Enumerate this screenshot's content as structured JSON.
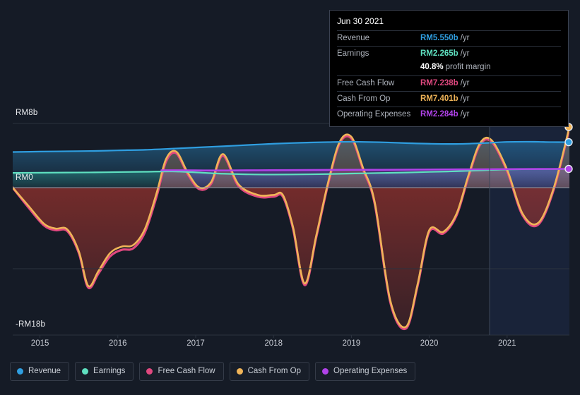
{
  "chart_data": {
    "type": "area",
    "title": "",
    "xlabel": "",
    "ylabel": "",
    "currency_prefix": "RM",
    "grid": true,
    "legend_position": "bottom",
    "x_tick_labels": [
      "2015",
      "2016",
      "2017",
      "2018",
      "2019",
      "2020",
      "2021"
    ],
    "x_tick_values": [
      2015,
      2016,
      2017,
      2018,
      2019,
      2020,
      2021
    ],
    "y_tick_labels": [
      "RM8b",
      "RM0",
      "-RM18b"
    ],
    "y_tick_values": [
      8,
      0,
      -18
    ],
    "ylim": [
      -18,
      8
    ],
    "xlim": [
      2014.65,
      2021.8
    ],
    "series": [
      {
        "name": "Revenue",
        "color": "#2f9ee0",
        "x": [
          2014.65,
          2015.0,
          2015.35,
          2015.7,
          2016.0,
          2016.35,
          2016.7,
          2017.0,
          2017.35,
          2017.7,
          2018.0,
          2018.35,
          2018.7,
          2019.0,
          2019.35,
          2019.7,
          2020.0,
          2020.35,
          2020.7,
          2021.0,
          2021.35,
          2021.55,
          2021.8
        ],
        "values": [
          4.35,
          4.4,
          4.44,
          4.48,
          4.55,
          4.62,
          4.76,
          4.9,
          5.05,
          5.22,
          5.36,
          5.48,
          5.56,
          5.6,
          5.55,
          5.44,
          5.36,
          5.33,
          5.44,
          5.58,
          5.6,
          5.56,
          5.55
        ]
      },
      {
        "name": "Earnings",
        "color": "#5fe0c0",
        "x": [
          2014.65,
          2015.0,
          2015.35,
          2015.7,
          2016.0,
          2016.35,
          2016.7,
          2017.0,
          2017.35,
          2017.7,
          2018.0,
          2018.35,
          2018.7,
          2019.0,
          2019.35,
          2019.7,
          2020.0,
          2020.35,
          2020.7,
          2021.0,
          2021.35,
          2021.55,
          2021.8
        ],
        "values": [
          1.8,
          1.82,
          1.84,
          1.86,
          1.9,
          1.94,
          1.98,
          1.86,
          1.7,
          1.62,
          1.6,
          1.62,
          1.66,
          1.72,
          1.78,
          1.84,
          1.92,
          2.0,
          2.12,
          2.22,
          2.26,
          2.27,
          2.265
        ]
      },
      {
        "name": "Free Cash Flow",
        "color": "#e0487f",
        "x": [
          2014.65,
          2014.85,
          2015.05,
          2015.2,
          2015.35,
          2015.5,
          2015.62,
          2015.75,
          2015.9,
          2016.05,
          2016.2,
          2016.35,
          2016.5,
          2016.62,
          2016.75,
          2016.9,
          2017.05,
          2017.2,
          2017.35,
          2017.55,
          2017.8,
          2018.0,
          2018.12,
          2018.25,
          2018.4,
          2018.55,
          2018.7,
          2018.85,
          2019.0,
          2019.15,
          2019.3,
          2019.5,
          2019.7,
          2019.85,
          2020.0,
          2020.18,
          2020.35,
          2020.5,
          2020.65,
          2020.8,
          2021.0,
          2021.2,
          2021.4,
          2021.6,
          2021.8
        ],
        "values": [
          0.0,
          -2.4,
          -4.6,
          -5.2,
          -5.3,
          -8.0,
          -12.2,
          -10.5,
          -8.4,
          -7.6,
          -7.4,
          -5.4,
          -1.0,
          3.2,
          4.2,
          1.6,
          -0.2,
          0.5,
          3.9,
          0.2,
          -1.1,
          -1.1,
          -1.1,
          -5.0,
          -11.9,
          -6.0,
          0.4,
          5.4,
          6.0,
          2.2,
          -2.0,
          -14.0,
          -17.2,
          -12.0,
          -5.4,
          -5.6,
          -3.4,
          1.2,
          5.2,
          5.6,
          2.0,
          -3.4,
          -4.5,
          -0.2,
          7.238
        ]
      },
      {
        "name": "Cash From Op",
        "color": "#f0b458",
        "x": [
          2014.65,
          2014.85,
          2015.05,
          2015.2,
          2015.35,
          2015.5,
          2015.62,
          2015.75,
          2015.9,
          2016.05,
          2016.2,
          2016.35,
          2016.5,
          2016.62,
          2016.75,
          2016.9,
          2017.05,
          2017.2,
          2017.35,
          2017.55,
          2017.8,
          2018.0,
          2018.12,
          2018.25,
          2018.4,
          2018.55,
          2018.7,
          2018.85,
          2019.0,
          2019.15,
          2019.3,
          2019.5,
          2019.7,
          2019.85,
          2020.0,
          2020.18,
          2020.35,
          2020.5,
          2020.65,
          2020.8,
          2021.0,
          2021.2,
          2021.4,
          2021.6,
          2021.8
        ],
        "values": [
          0.0,
          -2.2,
          -4.4,
          -5.0,
          -5.1,
          -7.8,
          -12.0,
          -10.2,
          -8.0,
          -7.2,
          -7.0,
          -5.0,
          -0.6,
          3.5,
          4.4,
          1.8,
          0.0,
          0.7,
          4.1,
          0.4,
          -0.9,
          -0.9,
          -0.9,
          -4.8,
          -11.7,
          -5.8,
          0.6,
          5.6,
          6.2,
          2.4,
          -1.8,
          -13.8,
          -17.0,
          -11.8,
          -5.2,
          -5.4,
          -3.2,
          1.4,
          5.4,
          5.8,
          2.2,
          -3.2,
          -4.3,
          0.0,
          7.401
        ]
      },
      {
        "name": "Operating Expenses",
        "color": "#b042e8",
        "x": [
          2016.56,
          2016.8,
          2017.1,
          2017.4,
          2017.8,
          2018.2,
          2018.6,
          2019.0,
          2019.4,
          2019.8,
          2020.2,
          2020.6,
          2021.0,
          2021.4,
          2021.8
        ],
        "values": [
          2.12,
          2.12,
          2.1,
          2.1,
          2.12,
          2.14,
          2.16,
          2.18,
          2.18,
          2.2,
          2.22,
          2.24,
          2.26,
          2.28,
          2.284
        ]
      }
    ]
  },
  "tooltip": {
    "date": "Jun 30 2021",
    "rows": [
      {
        "label": "Revenue",
        "value": "RM5.550b",
        "unit": "/yr",
        "color": "#2f9ee0"
      },
      {
        "label": "Earnings",
        "value": "RM2.265b",
        "unit": "/yr",
        "color": "#5fe0c0"
      },
      {
        "label": "Free Cash Flow",
        "value": "RM7.238b",
        "unit": "/yr",
        "color": "#e0487f"
      },
      {
        "label": "Cash From Op",
        "value": "RM7.401b",
        "unit": "/yr",
        "color": "#f0b458"
      },
      {
        "label": "Operating Expenses",
        "value": "RM2.284b",
        "unit": "/yr",
        "color": "#b042e8"
      }
    ],
    "sub_value": "40.8%",
    "sub_label": "profit margin"
  },
  "legend": {
    "items": [
      {
        "label": "Revenue",
        "color": "#2f9ee0"
      },
      {
        "label": "Earnings",
        "color": "#5fe0c0"
      },
      {
        "label": "Free Cash Flow",
        "color": "#e0487f"
      },
      {
        "label": "Cash From Op",
        "color": "#f0b458"
      },
      {
        "label": "Operating Expenses",
        "color": "#b042e8"
      }
    ]
  },
  "axis": {
    "y_top_label": "RM8b",
    "y_zero_label": "RM0",
    "y_bottom_label": "-RM18b"
  },
  "colors": {
    "background": "#151b26",
    "gridline": "#2c333f",
    "zero_line": "#8d93a0",
    "forecast_divider": "#3d4758"
  }
}
